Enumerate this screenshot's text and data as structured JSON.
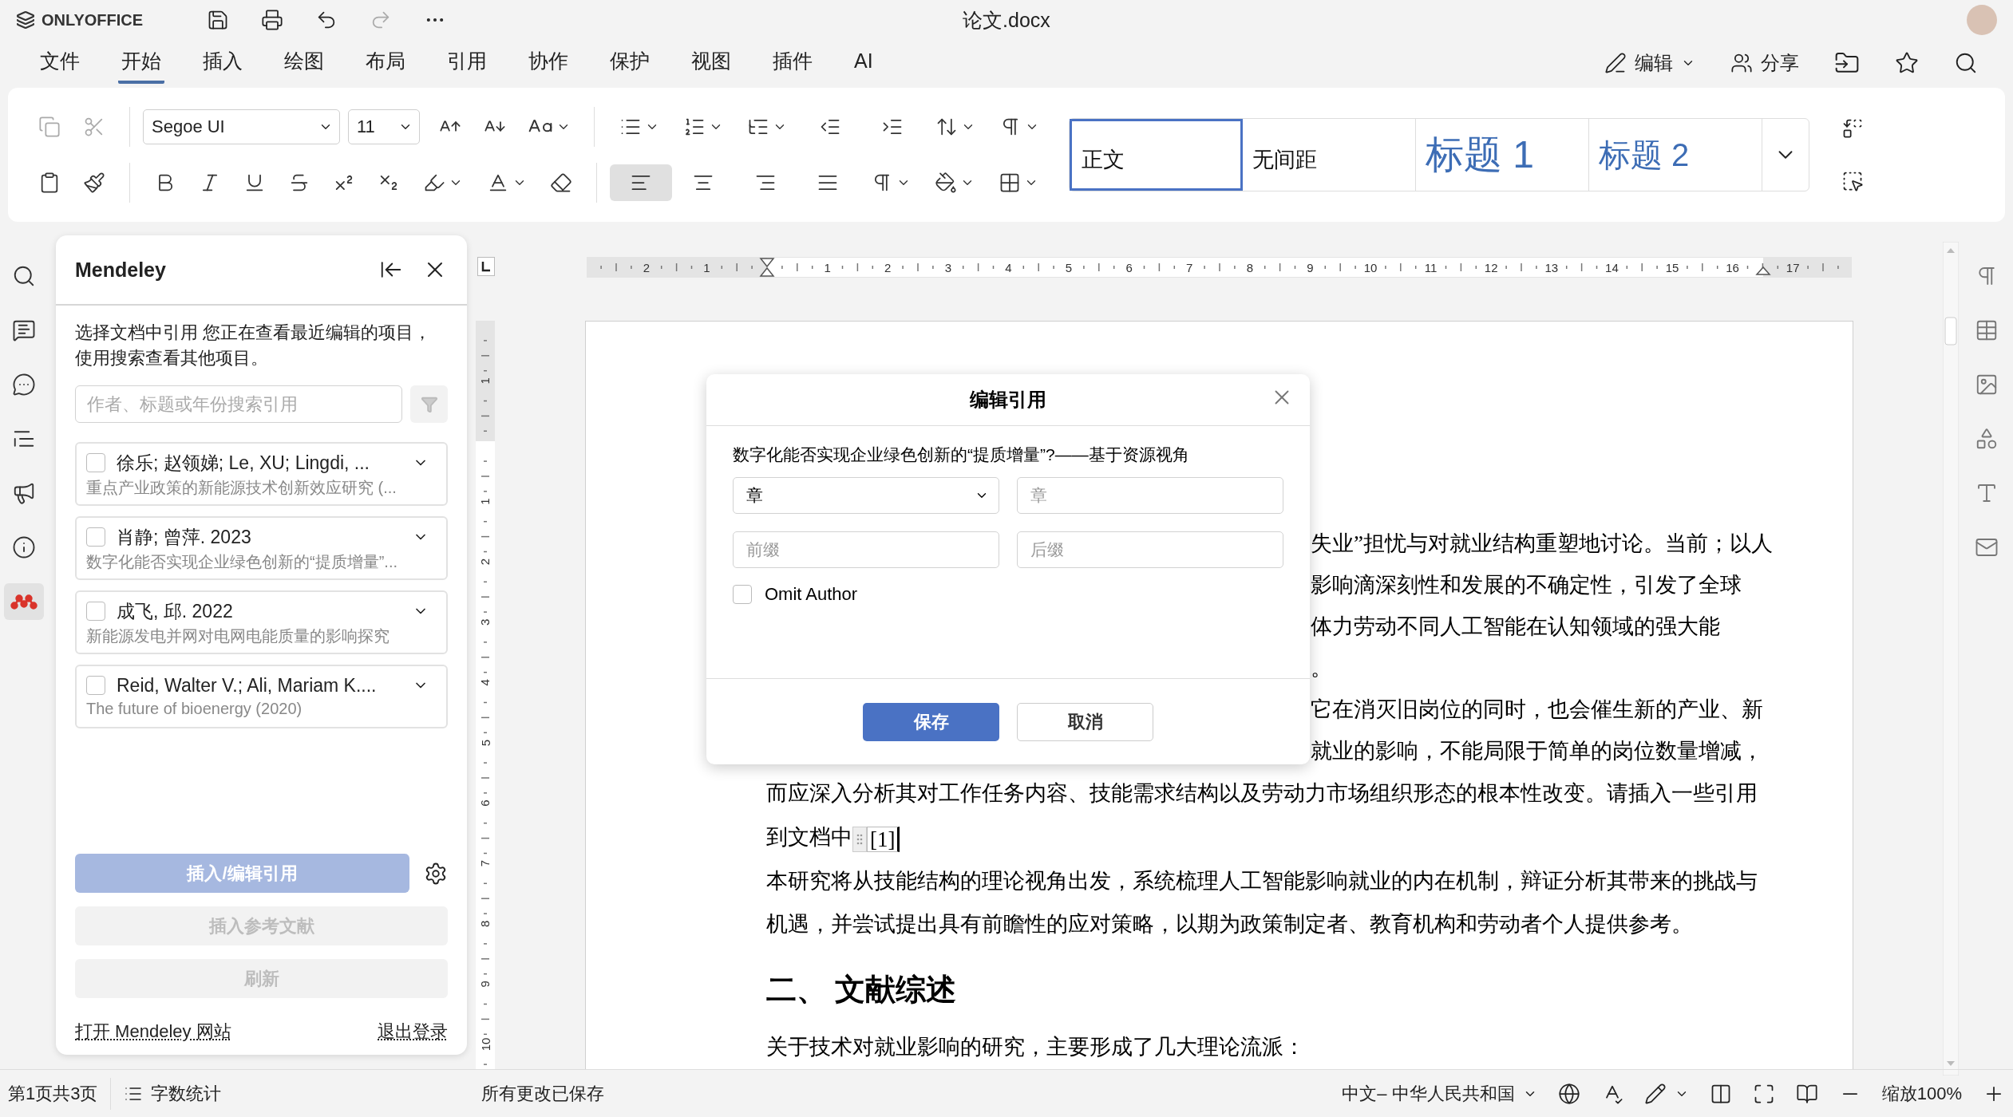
{
  "app": {
    "logo": "ONLYOFFICE",
    "title": "论文.docx"
  },
  "menu_tabs": [
    {
      "label": "文件",
      "selected": false
    },
    {
      "label": "开始",
      "selected": true
    },
    {
      "label": "插入",
      "selected": false
    },
    {
      "label": "绘图",
      "selected": false
    },
    {
      "label": "布局",
      "selected": false
    },
    {
      "label": "引用",
      "selected": false
    },
    {
      "label": "协作",
      "selected": false
    },
    {
      "label": "保护",
      "selected": false
    },
    {
      "label": "视图",
      "selected": false
    },
    {
      "label": "插件",
      "selected": false
    },
    {
      "label": "AI",
      "selected": false
    }
  ],
  "header_actions": {
    "edit": "编辑",
    "share": "分享"
  },
  "toolbar": {
    "font": "Segoe UI",
    "size": "11",
    "alignment_buttons": [
      {
        "kind": "left",
        "selected": true
      },
      {
        "kind": "center",
        "selected": false
      },
      {
        "kind": "right",
        "selected": false
      },
      {
        "kind": "justify",
        "selected": false
      }
    ]
  },
  "styles": [
    {
      "label": "正文",
      "kind": "body",
      "selected": true
    },
    {
      "label": "无间距",
      "kind": "body",
      "selected": false
    },
    {
      "label": "标题 1",
      "kind": "heading1",
      "selected": false
    },
    {
      "label": "标题 2",
      "kind": "heading2",
      "selected": false
    }
  ],
  "left_rail": [
    {
      "kind": "search",
      "selected": false
    },
    {
      "kind": "comments",
      "selected": false
    },
    {
      "kind": "chat",
      "selected": false
    },
    {
      "kind": "navigation",
      "selected": false
    },
    {
      "kind": "feedback",
      "selected": false
    },
    {
      "kind": "about",
      "selected": false
    },
    {
      "kind": "mendeley",
      "selected": true
    }
  ],
  "mendeley": {
    "title": "Mendeley",
    "intro": "选择文档中引用 您正在查看最近编辑的项目，使用搜索查看其他项目。",
    "search": {
      "placeholder": "作者、标题或年份搜索引用"
    },
    "items": [
      {
        "authors": "徐乐; 赵领娣; Le, XU; Lingdi, ...",
        "title": "重点产业政策的新能源技术创新效应研究 (...",
        "checked": false
      },
      {
        "authors": "肖静; 曾萍. 2023",
        "title": "数字化能否实现企业绿色创新的“提质增量”...",
        "checked": false
      },
      {
        "authors": "成飞, 邱. 2022",
        "title": "新能源发电并网对电网电能质量的影响探究",
        "checked": false
      },
      {
        "authors": "Reid, Walter V.; Ali, Mariam K....",
        "title": "The future of bioenergy (2020)",
        "checked": false
      }
    ],
    "buttons": [
      {
        "label": "插入/编辑引用",
        "kind": "primary",
        "disabled": true
      },
      {
        "label": "插入参考文献",
        "kind": "secondary",
        "disabled": true
      },
      {
        "label": "刷新",
        "kind": "secondary",
        "disabled": true
      }
    ],
    "links": [
      "打开 Mendeley 网站",
      "退出登录"
    ]
  },
  "rulers": {
    "horizontal": [
      "2",
      "1",
      "1",
      "2",
      "3",
      "4",
      "5",
      "6",
      "7",
      "8",
      "9",
      "10",
      "11",
      "12",
      "13",
      "14",
      "15",
      "16",
      "17"
    ],
    "vertical": [
      "1",
      "1",
      "2",
      "3",
      "4",
      "5",
      "6",
      "7",
      "8",
      "9",
      "10"
    ]
  },
  "document": {
    "lines": [
      {
        "kind": "partial",
        "text": "失业”担忧与对就业结构重塑地讨论。当前；以人"
      },
      {
        "kind": "partial",
        "text": "影响滴深刻性和发展的不确定性，引发了全球"
      },
      {
        "kind": "partial",
        "text": "体力劳动不同人工智能在认知领域的强大能"
      },
      {
        "kind": "partial",
        "text": "。"
      },
      {
        "kind": "partial",
        "text": "它在消灭旧岗位的同时，也会催生新的产业、新"
      },
      {
        "kind": "partial",
        "text": "就业的影响，不能局限于简单的岗位数量增减，"
      },
      {
        "kind": "line",
        "text": "而应深入分析其对工作任务内容、技能需求结构以及劳动力市场组织形态的根本性改变。请插入一些引用"
      },
      {
        "kind": "citation",
        "text": "到文档中",
        "citation": "[1]"
      },
      {
        "kind": "line",
        "text": "本研究将从技能结构的理论视角出发，系统梳理人工智能影响就业的内在机制，辩证分析其带来的挑战与"
      },
      {
        "kind": "line",
        "text": "机遇，并尝试提出具有前瞻性的应对策略，以期为政策制定者、教育机构和劳动者个人提供参考。"
      },
      {
        "kind": "heading",
        "text": "二、 文献综述"
      },
      {
        "kind": "line",
        "text": "关于技术对就业影响的研究，主要形成了几大理论流派："
      }
    ]
  },
  "dialog": {
    "title": "编辑引用",
    "source": "数字化能否实现企业绿色创新的“提质增量”?——基于资源视角",
    "fields": [
      {
        "kind": "select",
        "value": "章"
      },
      {
        "kind": "input",
        "placeholder": "章"
      },
      {
        "kind": "input",
        "placeholder": "前缀"
      },
      {
        "kind": "input",
        "placeholder": "后缀"
      }
    ],
    "omit_author": {
      "label": "Omit Author",
      "checked": false
    },
    "buttons": [
      {
        "label": "保存",
        "kind": "primary"
      },
      {
        "label": "取消",
        "kind": "secondary"
      }
    ]
  },
  "right_rail": [
    {
      "kind": "paragraph"
    },
    {
      "kind": "table"
    },
    {
      "kind": "image"
    },
    {
      "kind": "shapes"
    },
    {
      "kind": "textart"
    },
    {
      "kind": "mail"
    }
  ],
  "status_bar": {
    "page": "第1页共3页",
    "word_count": "字数统计",
    "save_status": "所有更改已保存",
    "language": "中文– 中华人民共和国",
    "zoom": "缩放100%"
  }
}
